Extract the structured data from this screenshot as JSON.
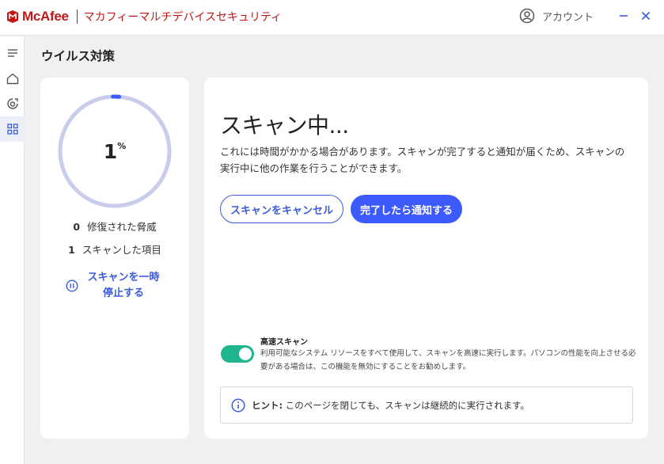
{
  "header": {
    "brand": "McAfee",
    "product_title": "マカフィーマルチデバイスセキュリティ",
    "account_label": "アカウント",
    "minimize_icon": "minimize-icon",
    "close_icon": "close-icon",
    "brand_color": "#c01818"
  },
  "sidebar": {
    "items": [
      {
        "icon": "menu-icon",
        "active": false
      },
      {
        "icon": "home-icon",
        "active": false
      },
      {
        "icon": "privacy-shield-icon",
        "active": false
      },
      {
        "icon": "apps-grid-icon",
        "active": true
      }
    ]
  },
  "page": {
    "title": "ウイルス対策"
  },
  "progress": {
    "percent_value": 1,
    "percent_text": "1",
    "percent_sign": "%",
    "ring_color": "#c9cdeb",
    "progress_color": "#3d5afe"
  },
  "stats": {
    "threats_fixed_count": "0",
    "threats_fixed_label": "修復された脅威",
    "items_scanned_count": "1",
    "items_scanned_label": "スキャンした項目"
  },
  "pause": {
    "line1": "スキャンを一時",
    "line2": "停止する",
    "icon": "pause-circle-icon"
  },
  "scan": {
    "title": "スキャン中...",
    "description": "これには時間がかかる場合があります。スキャンが完了すると通知が届くため、スキャンの実行中に他の作業を行うことができます。",
    "cancel_label": "スキャンをキャンセル",
    "notify_label": "完了したら通知する",
    "accent_color": "#3d5afe"
  },
  "fast_scan": {
    "title": "高速スキャン",
    "description": "利用可能なシステム リソースをすべて使用して、スキャンを高速に実行します。パソコンの性能を向上させる必要がある場合は、この機能を無効にすることをお勧めします。",
    "enabled": true,
    "toggle_color": "#1fb58f"
  },
  "hint": {
    "icon": "info-icon",
    "label": "ヒント:",
    "text": " このページを閉じても、スキャンは継続的に実行されます。"
  }
}
